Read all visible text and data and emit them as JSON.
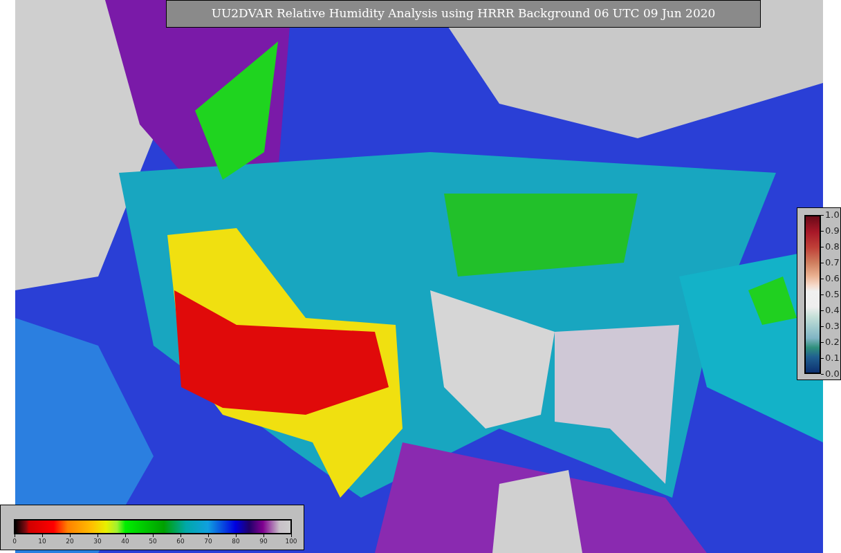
{
  "title": "UU2DVAR Relative Humidity Analysis using HRRR Background 06 UTC 09 Jun 2020",
  "humidity_scale": {
    "ticks": [
      "0",
      "10",
      "20",
      "30",
      "40",
      "50",
      "60",
      "70",
      "80",
      "90",
      "100"
    ]
  },
  "station_scale": {
    "ticks": [
      "1.0",
      "0.9",
      "0.8",
      "0.7",
      "0.6",
      "0.5",
      "0.4",
      "0.3",
      "0.2",
      "0.1",
      "0.0"
    ]
  }
}
